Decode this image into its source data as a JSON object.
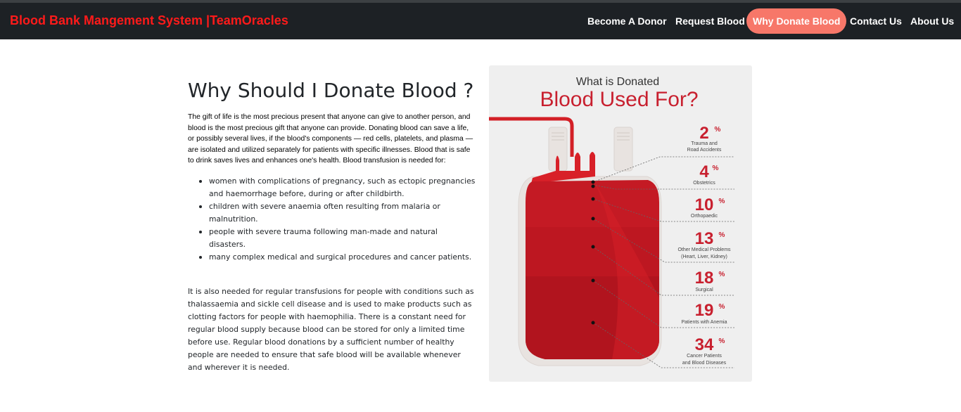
{
  "navbar": {
    "brand": "Blood Bank Mangement System |TeamOracles",
    "links": [
      {
        "label": "Become A Donor",
        "active": false
      },
      {
        "label": "Request Blood",
        "active": false
      },
      {
        "label": "Why Donate Blood",
        "active": true
      },
      {
        "label": "Contact Us",
        "active": false
      },
      {
        "label": "About Us",
        "active": false
      }
    ]
  },
  "main": {
    "title": "Why Should I Donate Blood ?",
    "intro": "The gift of life is the most precious present that anyone can give to another person, and blood is the most precious gift that anyone can provide. Donating blood can save a life, or possibly several lives, if the blood's components — red cells, platelets, and plasma — are isolated and utilized separately for patients with specific illnesses. Blood that is safe to drink saves lives and enhances one's health. Blood transfusion is needed for:",
    "bullets": [
      "women with complications of pregnancy, such as ectopic pregnancies and haemorrhage before, during or after childbirth.",
      "children with severe anaemia often resulting from malaria or malnutrition.",
      "people with severe trauma following man-made and natural disasters.",
      "many complex medical and surgical procedures and cancer patients."
    ],
    "paragraph2": "It is also needed for regular transfusions for people with conditions such as thalassaemia and sickle cell disease and is used to make products such as clotting factors for people with haemophilia. There is a constant need for regular blood supply because blood can be stored for only a limited time before use. Regular blood donations by a sufficient number of healthy people are needed to ensure that safe blood will be available whenever and wherever it is needed."
  },
  "infographic": {
    "heading_small": "What is Donated",
    "heading_large": "Blood Used For?",
    "percent_sign": "%",
    "items": [
      {
        "value": "2",
        "label1": "Trauma and",
        "label2": "Road Accidents"
      },
      {
        "value": "4",
        "label1": "Obstetrics",
        "label2": ""
      },
      {
        "value": "10",
        "label1": "Orthopaedic",
        "label2": ""
      },
      {
        "value": "13",
        "label1": "Other Medical Problems",
        "label2": "(Heart, Liver, Kidney)"
      },
      {
        "value": "18",
        "label1": "Surgical",
        "label2": ""
      },
      {
        "value": "19",
        "label1": "Patients with Anemia",
        "label2": ""
      },
      {
        "value": "34",
        "label1": "Cancer Patients",
        "label2": "and Blood Diseases"
      }
    ],
    "colors": {
      "red": "#c8202f",
      "bag_red_dark": "#a8121c",
      "bag_red_mid": "#c41a24",
      "bag_red_light": "#d82028",
      "bag_shell": "#e8e3e0",
      "background": "#efefef"
    }
  }
}
